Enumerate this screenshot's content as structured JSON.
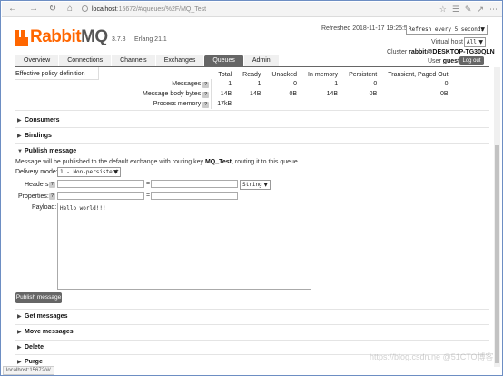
{
  "browser": {
    "url_host": "localhost",
    "url_rest": ":15672/#/queues/%2F/MQ_Test",
    "status_url": "localhost:15672/#/"
  },
  "header": {
    "logo_rabbit": "Rabbit",
    "logo_mq": "MQ",
    "version": "3.7.8",
    "erlang": "Erlang 21.1",
    "refreshed": "Refreshed 2018-11-17 19:25:52",
    "refresh_select": "Refresh every 5 seconds",
    "vhost_label": "Virtual host",
    "vhost_select": "All",
    "cluster_label": "Cluster",
    "cluster_value": "rabbit@DESKTOP-TG30QLN",
    "user_label": "User",
    "user_value": "guest",
    "logout": "Log out"
  },
  "tabs": [
    "Overview",
    "Connections",
    "Channels",
    "Exchanges",
    "Queues",
    "Admin"
  ],
  "active_tab": "Queues",
  "policy_label": "Effective policy definition",
  "stats": {
    "headers": [
      "Total",
      "Ready",
      "Unacked",
      "In memory",
      "Persistent",
      "Transient, Paged Out"
    ],
    "rows": [
      {
        "label": "Messages",
        "values": [
          "1",
          "1",
          "0",
          "1",
          "0",
          "0"
        ]
      },
      {
        "label": "Message body bytes",
        "values": [
          "14B",
          "14B",
          "0B",
          "14B",
          "0B",
          "0B"
        ]
      },
      {
        "label": "Process memory",
        "values": [
          "17kB"
        ]
      }
    ]
  },
  "sections": {
    "consumers": "Consumers",
    "bindings": "Bindings",
    "publish": "Publish message",
    "get": "Get messages",
    "move": "Move messages",
    "delete": "Delete",
    "purge": "Purge"
  },
  "publish": {
    "note_pre": "Message will be published to the default exchange with routing key ",
    "routing_key": "MQ_Test",
    "note_post": ", routing it to this queue.",
    "delivery_label": "Delivery mode:",
    "delivery_value": "1 - Non-persistent",
    "headers_label": "Headers:",
    "properties_label": "Properties:",
    "type_value": "String",
    "payload_label": "Payload:",
    "payload_value": "Hello world!!!",
    "button": "Publish message"
  },
  "watermark": "https://blog.csdn.ne @51CTO博客"
}
